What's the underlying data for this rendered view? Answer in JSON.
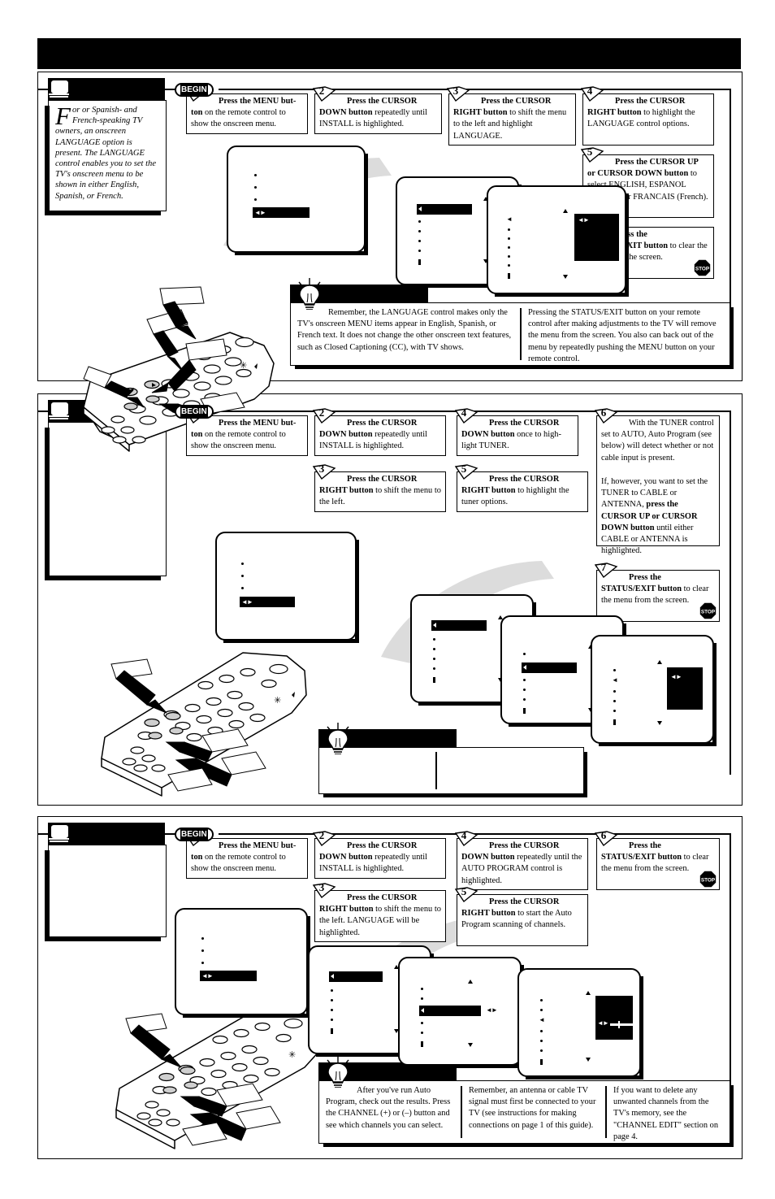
{
  "document": {
    "masthead_title": "",
    "page_footer": ""
  },
  "sections": [
    {
      "id": "language",
      "header_title": "",
      "icon": "tv-icon",
      "begin_label": "BEGIN",
      "intro": {
        "dropcap": "F",
        "text": "or or Spanish- and French-speaking TV owners, an onscreen LANGUAGE option is present. The LANGUAGE control enables you to set the TV's onscreen menu to be shown in either English, Spanish, or French."
      },
      "steps": [
        {
          "n": "1",
          "html": "<b>Press the MENU but-</b> <b>ton</b> on the remote control to show the onscreen menu."
        },
        {
          "n": "2",
          "html": "<b>Press the CURSOR DOWN button</b> repeatedly until INSTALL is highlighted."
        },
        {
          "n": "3",
          "html": "<b>Press the CURSOR RIGHT button</b> to shift the menu to the left and highlight LANGUAGE."
        },
        {
          "n": "4",
          "html": "<b>Press the CURSOR RIGHT button</b> to highlight the LANGUAGE control options."
        },
        {
          "n": "5",
          "html": "<b>Press the CURSOR UP or CURSOR DOWN button</b> to select ENGLISH, ESPANOL (Spanish), or FRANCAIS (French)."
        },
        {
          "n": "6",
          "html": "<b>Press the STATUS/EXIT button</b> to clear the menu from the screen.",
          "stop": true
        }
      ],
      "tip": {
        "bar_label": "",
        "columns": [
          "Remember, the LANGUAGE control makes only the TV's onscreen MENU items appear in English, Spanish, or French text.  It does not change the other onscreen text features, such as Closed Captioning (CC), with TV shows.",
          "Pressing the STATUS/EXIT button on your remote control after making adjustments to the TV will remove the menu from the screen.  You also can back out of the menu by repeatedly pushing the MENU button on your remote control."
        ]
      }
    },
    {
      "id": "tuner",
      "header_title": "",
      "icon": "tv-icon",
      "begin_label": "BEGIN",
      "intro": {
        "dropcap": "",
        "text": ""
      },
      "steps": [
        {
          "n": "1",
          "html": "<b>Press the MENU but-</b> <b>ton</b> on the remote control to show the onscreen menu."
        },
        {
          "n": "2",
          "html": "<b>Press the CURSOR DOWN button</b> repeatedly until INSTALL is highlighted."
        },
        {
          "n": "3",
          "html": "<b>Press the CURSOR RIGHT button</b> to shift the menu to the left."
        },
        {
          "n": "4",
          "html": "<b>Press the CURSOR DOWN button</b> once to high-light TUNER."
        },
        {
          "n": "5",
          "html": "<b>Press the CURSOR RIGHT button</b> to highlight the tuner options."
        },
        {
          "n": "6",
          "html": "With the TUNER control set to AUTO,  Auto Program (see below) will detect whether or not cable input is present."
        },
        {
          "n": "6b",
          "html": "If, however, you want to set the TUNER to CABLE or ANTENNA, <b>press the CURSOR UP or CURSOR DOWN button</b> until either CABLE or ANTENNA is highlighted."
        },
        {
          "n": "7",
          "html": "<b>Press the STATUS/EXIT button</b> to clear the menu from the screen.",
          "stop": true
        }
      ],
      "tip": {
        "bar_label": "",
        "columns": [
          "",
          ""
        ]
      }
    },
    {
      "id": "auto-program",
      "header_title": "",
      "icon": "tv-icon",
      "begin_label": "BEGIN",
      "intro": {
        "dropcap": "",
        "text": ""
      },
      "steps": [
        {
          "n": "1",
          "html": "<b>Press the MENU but-</b> <b>ton</b> on the remote control to show the onscreen menu."
        },
        {
          "n": "2",
          "html": "<b>Press the CURSOR DOWN button</b> repeatedly until INSTALL is highlighted."
        },
        {
          "n": "3",
          "html": "<b>Press the CURSOR RIGHT button</b> to shift the menu to the left. LANGUAGE will be highlighted."
        },
        {
          "n": "4",
          "html": "<b>Press the CURSOR DOWN button</b> repeatedly until the AUTO PROGRAM control is highlighted."
        },
        {
          "n": "5",
          "html": "<b>Press the CURSOR RIGHT button</b> to start the Auto Program scanning of channels."
        },
        {
          "n": "6",
          "html": "<b>Press the STATUS/EXIT button</b> to clear the menu from the screen.",
          "stop": true
        }
      ],
      "tip": {
        "bar_label": "",
        "columns": [
          "After you've run Auto Program, check out the results.  Press the CHANNEL (+) or (–) button and see which channels you can select.",
          "Remember, an antenna or cable TV signal must first be connected to your TV (see instructions for making connections on page 1 of this guide).",
          "If you want to delete any unwanted channels from the TV's memory, see the \"CHANNEL EDIT\" section on page 4."
        ]
      }
    }
  ],
  "icons": {
    "stop": "STOP",
    "bulb": "lightbulb-icon",
    "tv": "tv-icon"
  },
  "colors": {
    "ink": "#000000",
    "paper": "#ffffff",
    "shadow": "#d8d8d8"
  }
}
